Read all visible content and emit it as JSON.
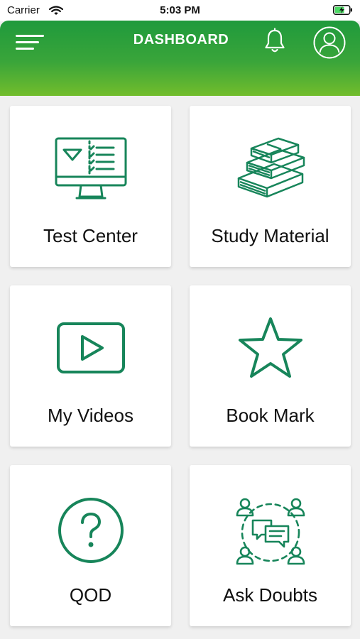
{
  "status_bar": {
    "carrier": "Carrier",
    "time": "5:03 PM",
    "wifi_icon": "wifi-icon",
    "battery_icon": "battery-charging-icon"
  },
  "header": {
    "title": "DASHBOARD",
    "menu_icon": "hamburger-menu-icon",
    "bell_icon": "bell-icon",
    "profile_icon": "user-profile-icon",
    "gradient_top": "#1f9a3c",
    "gradient_bottom": "#72bd2c"
  },
  "theme": {
    "icon_color": "#17855a"
  },
  "cards": [
    {
      "label": "Test Center",
      "icon": "computer-test-icon"
    },
    {
      "label": "Study Material",
      "icon": "books-icon"
    },
    {
      "label": "My Videos",
      "icon": "play-video-icon"
    },
    {
      "label": "Book Mark",
      "icon": "star-icon"
    },
    {
      "label": "QOD",
      "icon": "question-icon"
    },
    {
      "label": "Ask Doubts",
      "icon": "discussion-icon"
    }
  ]
}
